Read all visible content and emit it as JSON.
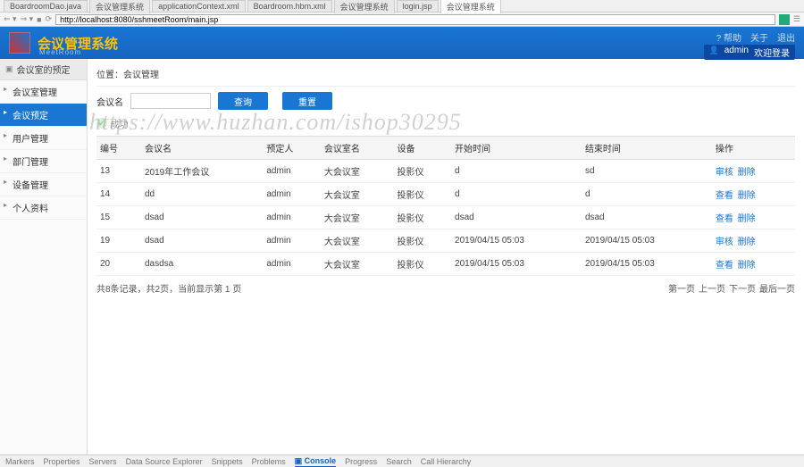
{
  "ide_tabs": [
    "BoardroomDao.java",
    "会议管理系统",
    "applicationContext.xml",
    "Boardroom.hbm.xml",
    "会议管理系统",
    "login.jsp",
    "会议管理系统"
  ],
  "active_ide_tab": 6,
  "address": "http://localhost:8080/sshmeetRoom/main.jsp",
  "header": {
    "title": "会议管理系统",
    "subtitle": "MeetRoom",
    "links": [
      "帮助",
      "关于",
      "退出"
    ],
    "user": "admin",
    "welcome": "欢迎登录"
  },
  "sidebar": {
    "head": "会议室的预定",
    "items": [
      "会议室管理",
      "会议预定",
      "用户管理",
      "部门管理",
      "设备管理",
      "个人资料"
    ],
    "active": 1
  },
  "breadcrumb": "位置：会议管理",
  "search": {
    "label": "会议名",
    "btn_query": "查询",
    "btn_reset": "重置"
  },
  "result_label": "成功",
  "watermark": "https://www.huzhan.com/ishop30295",
  "table": {
    "cols": [
      "编号",
      "会议名",
      "预定人",
      "会议室名",
      "设备",
      "开始时间",
      "结束时间",
      "操作"
    ],
    "rows": [
      {
        "id": "13",
        "name": "2019年工作会议",
        "booker": "admin",
        "room": "大会议室",
        "device": "投影仪",
        "start": "d",
        "end": "sd",
        "a1": "审核",
        "a2": "删除"
      },
      {
        "id": "14",
        "name": "dd",
        "booker": "admin",
        "room": "大会议室",
        "device": "投影仪",
        "start": "d",
        "end": "d",
        "a1": "查看",
        "a2": "删除"
      },
      {
        "id": "15",
        "name": "dsad",
        "booker": "admin",
        "room": "大会议室",
        "device": "投影仪",
        "start": "dsad",
        "end": "dsad",
        "a1": "查看",
        "a2": "删除"
      },
      {
        "id": "19",
        "name": "dsad",
        "booker": "admin",
        "room": "大会议室",
        "device": "投影仪",
        "start": "2019/04/15 05:03",
        "end": "2019/04/15 05:03",
        "a1": "审核",
        "a2": "删除"
      },
      {
        "id": "20",
        "name": "dasdsa",
        "booker": "admin",
        "room": "大会议室",
        "device": "投影仪",
        "start": "2019/04/15 05:03",
        "end": "2019/04/15 05:03",
        "a1": "查看",
        "a2": "删除"
      }
    ]
  },
  "pager": {
    "left": "共8条记录，共2页，当前显示第 1 页",
    "links": [
      "第一页",
      "上一页",
      "下一页",
      "最后一页"
    ]
  },
  "bottom_tabs": [
    "Markers",
    "Properties",
    "Servers",
    "Data Source Explorer",
    "Snippets",
    "Problems",
    "Console",
    "Progress",
    "Search",
    "Call Hierarchy"
  ],
  "bottom_active": 6
}
